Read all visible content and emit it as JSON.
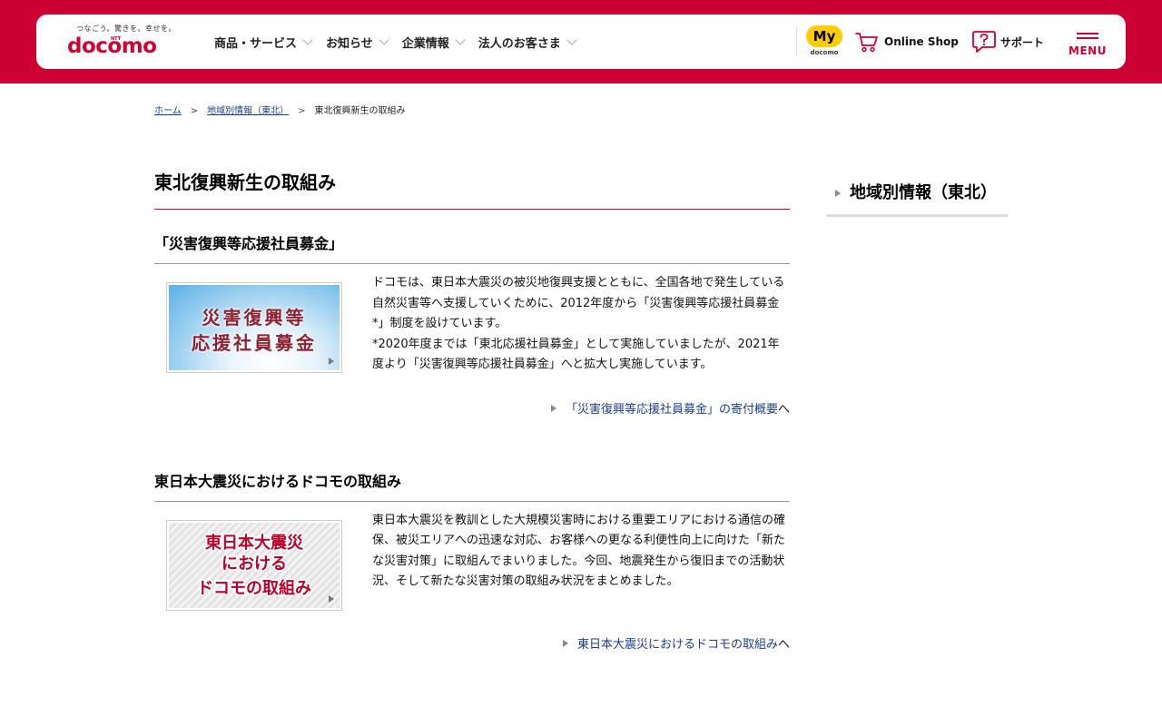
{
  "header": {
    "brand": {
      "tagline": "つなごう。驚きを。幸せを。",
      "ntt": "NTT",
      "wordmark": "docomo"
    },
    "nav": [
      {
        "label": "商品・サービス"
      },
      {
        "label": "お知らせ"
      },
      {
        "label": "企業情報"
      },
      {
        "label": "法人のお客さま"
      }
    ],
    "my_docomo": {
      "badge": "My",
      "sub": "docomo"
    },
    "online_shop": "Online Shop",
    "support": "サポート",
    "menu": "MENU"
  },
  "breadcrumb": {
    "home": "ホーム",
    "sep": ">",
    "region": "地域別情報（東北）",
    "current": "東北復興新生の取組み"
  },
  "main": {
    "title": "東北復興新生の取組み",
    "sections": [
      {
        "title": "「災害復興等応援社員募金」",
        "banner": {
          "line1": "災害復興等",
          "line2": "応援社員募金"
        },
        "text": "ドコモは、東日本大震災の被災地復興支援とともに、全国各地で発生している自然災害等へ支援していくために、2012年度から「災害復興等応援社員募金*」制度を設けています。",
        "note": "*2020年度までは「東北応援社員募金」として実施していましたが、2021年度より「災害復興等応援社員募金」へと拡大し実施しています。",
        "link": "「災害復興等応援社員募金」の寄付概要",
        "link_suffix": "へ"
      },
      {
        "title": "東日本大震災におけるドコモの取組み",
        "banner": {
          "line1": "東日本大震災",
          "line2": "における",
          "line3": "ドコモの取組み"
        },
        "text": "東日本大震災を教訓とした大規模災害時における重要エリアにおける通信の確保、被災エリアへの迅速な対応、お客様への更なる利便性向上に向けた「新たな災害対策」に取組んでまいりました。今回、地震発生から復旧までの活動状況、そして新たな災害対策の取組み状況をまとめました。",
        "link": "東日本大震災におけるドコモの取組み",
        "link_suffix": "へ"
      }
    ]
  },
  "sidebar": {
    "title": "地域別情報（東北）"
  },
  "colors": {
    "brand": "#cc0033",
    "link": "#1a3e8c",
    "mydocomo": "#ffcc00"
  }
}
